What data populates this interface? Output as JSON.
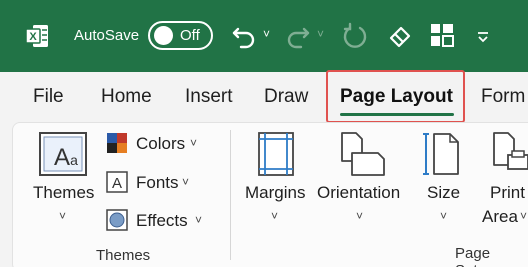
{
  "titlebar": {
    "autosave_label": "AutoSave",
    "toggle_state": "Off",
    "icons": [
      "excel-icon",
      "undo-icon",
      "redo-icon",
      "refresh-icon",
      "eraser-icon",
      "grid-icon",
      "quick-access-dropdown-icon"
    ],
    "color": "#217346"
  },
  "tabs": [
    {
      "label": "File"
    },
    {
      "label": "Home"
    },
    {
      "label": "Insert"
    },
    {
      "label": "Draw"
    },
    {
      "label": "Page Layout",
      "active": true
    },
    {
      "label": "Form"
    }
  ],
  "ribbon": {
    "themes_group": {
      "themes_label": "Themes",
      "colors_label": "Colors",
      "fonts_label": "Fonts",
      "effects_label": "Effects",
      "group_label": "Themes"
    },
    "page_setup_group": {
      "margins_label": "Margins",
      "orientation_label": "Orientation",
      "size_label": "Size",
      "print_area_line1": "Print",
      "print_area_line2": "Area",
      "group_label": "Page Setup"
    }
  },
  "colors": {
    "accent": "#217346",
    "highlight": "#e0524f"
  }
}
